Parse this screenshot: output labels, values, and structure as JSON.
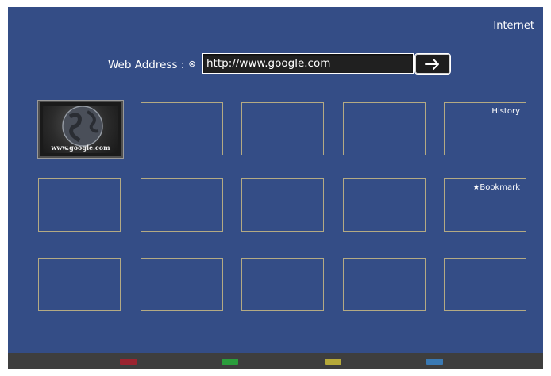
{
  "header": {
    "title": "Internet"
  },
  "address_bar": {
    "label": "Web Address :",
    "clear_icon": "clear-circle-icon",
    "value": "http://www.google.com",
    "go_icon": "arrow-right-icon"
  },
  "tiles": {
    "thumbnail_caption": "www.google.com",
    "history_label": "History",
    "bookmark_label": "★Bookmark"
  },
  "bottom_bar": {
    "keys": [
      {
        "name": "red-key",
        "color": "#9b2430"
      },
      {
        "name": "green-key",
        "color": "#2a9d3c"
      },
      {
        "name": "yellow-key",
        "color": "#b6a93a"
      },
      {
        "name": "blue-key",
        "color": "#3a79b3"
      }
    ]
  },
  "colors": {
    "background": "#344d86",
    "tile_border": "#b4aa83",
    "bottom_bar": "#3e3e3e"
  }
}
